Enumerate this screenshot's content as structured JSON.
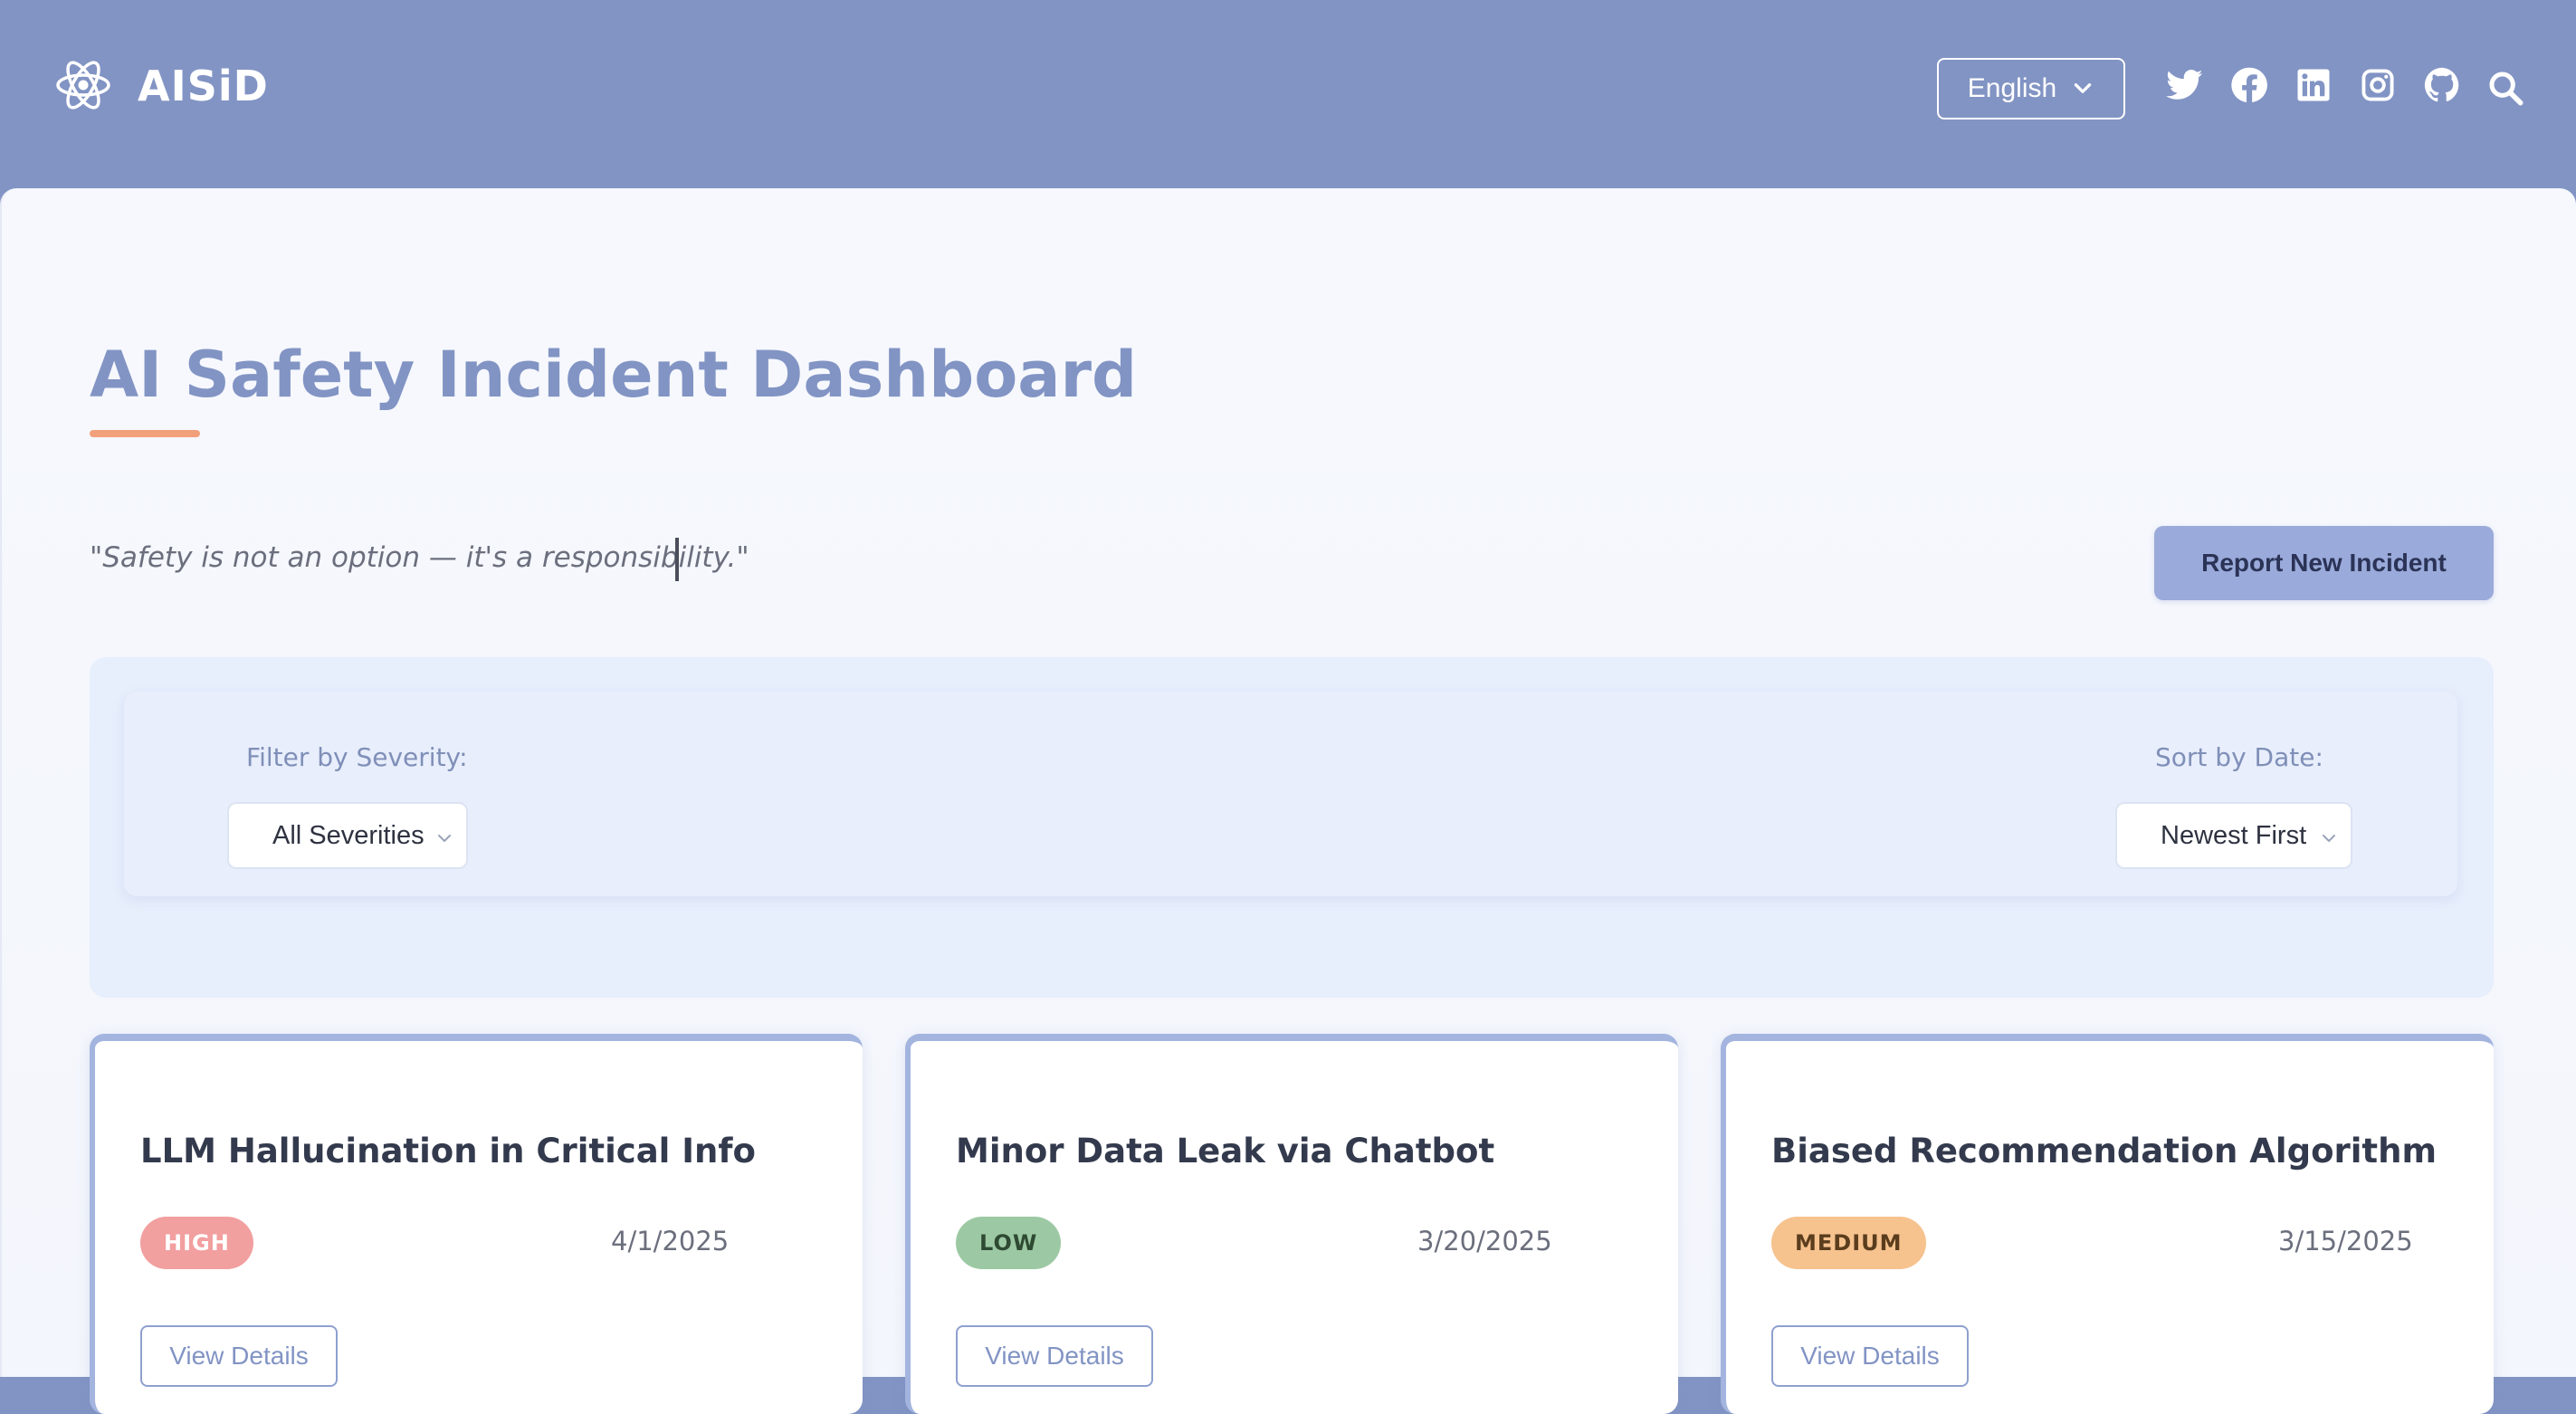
{
  "header": {
    "brand": "AISiD",
    "logo_icon": "atom-icon",
    "language": {
      "selected": "English",
      "icon": "chevron-down-icon"
    },
    "social": [
      "twitter-icon",
      "facebook-icon",
      "linkedin-icon",
      "instagram-icon",
      "github-icon",
      "search-icon"
    ]
  },
  "main": {
    "title": "AI Safety Incident Dashboard",
    "quote": "\"Safety is not an option — it's a responsibility.\"",
    "report_button": "Report New Incident"
  },
  "filters": {
    "severity_label": "Filter by Severity:",
    "severity_selected": "All Severities",
    "sort_label": "Sort by Date:",
    "sort_selected": "Newest First"
  },
  "incidents": [
    {
      "title": "LLM Hallucination in Critical Info",
      "severity": "HIGH",
      "date": "4/1/2025",
      "button": "View Details"
    },
    {
      "title": "Minor Data Leak via Chatbot",
      "severity": "LOW",
      "date": "3/20/2025",
      "button": "View Details"
    },
    {
      "title": "Biased Recommendation Algorithm",
      "severity": "MEDIUM",
      "date": "3/15/2025",
      "button": "View Details"
    }
  ],
  "colors": {
    "header_bg": "#8294c4",
    "accent_underline": "#f2a07b",
    "severity_high": "#f29f9f",
    "severity_low": "#9cc9a3",
    "severity_medium": "#f6c28e"
  }
}
